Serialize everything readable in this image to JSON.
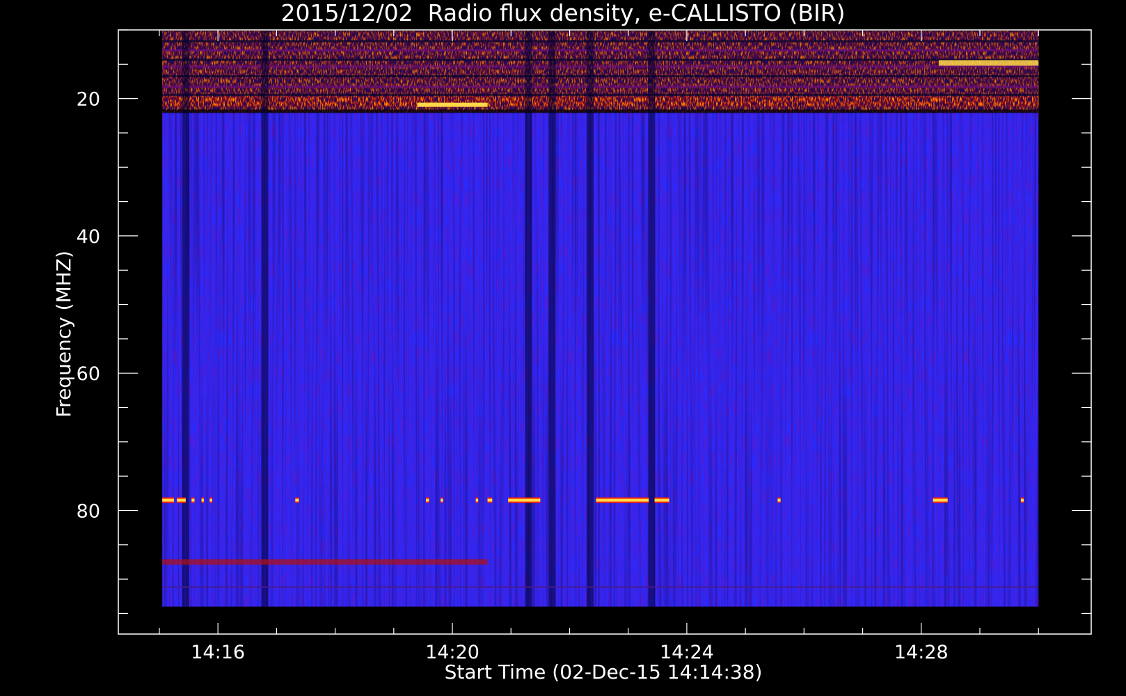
{
  "chart_data": {
    "type": "heatmap",
    "title": "2015/12/02  Radio flux density, e-CALLISTO (BIR)",
    "xlabel": "Start Time (02-Dec-15 14:14:38)",
    "ylabel": "Frequency (MHZ)",
    "x_axis": {
      "range_minutes": [
        14.3,
        30.9
      ],
      "data_start_minute": 15.05,
      "data_end_minute": 30.0,
      "major_ticks": [
        {
          "minute": 16,
          "label": "14:16"
        },
        {
          "minute": 20,
          "label": "14:20"
        },
        {
          "minute": 24,
          "label": "14:24"
        },
        {
          "minute": 28,
          "label": "14:28"
        }
      ],
      "minor_tick_step_minutes": 1
    },
    "y_axis": {
      "range_mhz": [
        10,
        98
      ],
      "inverted": true,
      "data_range_mhz": [
        10.2,
        94
      ],
      "major_ticks": [
        {
          "value": 20,
          "label": "20"
        },
        {
          "value": 40,
          "label": "40"
        },
        {
          "value": 60,
          "label": "60"
        },
        {
          "value": 80,
          "label": "80"
        }
      ],
      "minor_tick_step_mhz": 5
    },
    "colormap": [
      "#000000",
      "#1a1aff",
      "#2b2bff",
      "#b01010",
      "#ff2a00",
      "#ffd84a"
    ],
    "features": {
      "rfi_band_mhz": [
        10.2,
        22
      ],
      "bright_band_mhz": 20.4,
      "dark_columns_minutes": [
        15.45,
        16.8,
        21.3,
        21.7,
        22.35,
        23.4
      ],
      "interference_line_mhz": 78.5,
      "interference_segments_minutes": [
        [
          15.05,
          15.25
        ],
        [
          15.3,
          15.45
        ],
        [
          15.55,
          15.6
        ],
        [
          15.72,
          15.76
        ],
        [
          15.86,
          15.9
        ],
        [
          17.32,
          17.38
        ],
        [
          19.55,
          19.6
        ],
        [
          19.8,
          19.84
        ],
        [
          20.4,
          20.44
        ],
        [
          20.6,
          20.68
        ],
        [
          20.95,
          21.5
        ],
        [
          22.45,
          23.35
        ],
        [
          23.45,
          23.7
        ],
        [
          25.55,
          25.6
        ],
        [
          28.2,
          28.45
        ],
        [
          29.7,
          29.75
        ]
      ],
      "weak_band_mhz": 87.5
    }
  }
}
